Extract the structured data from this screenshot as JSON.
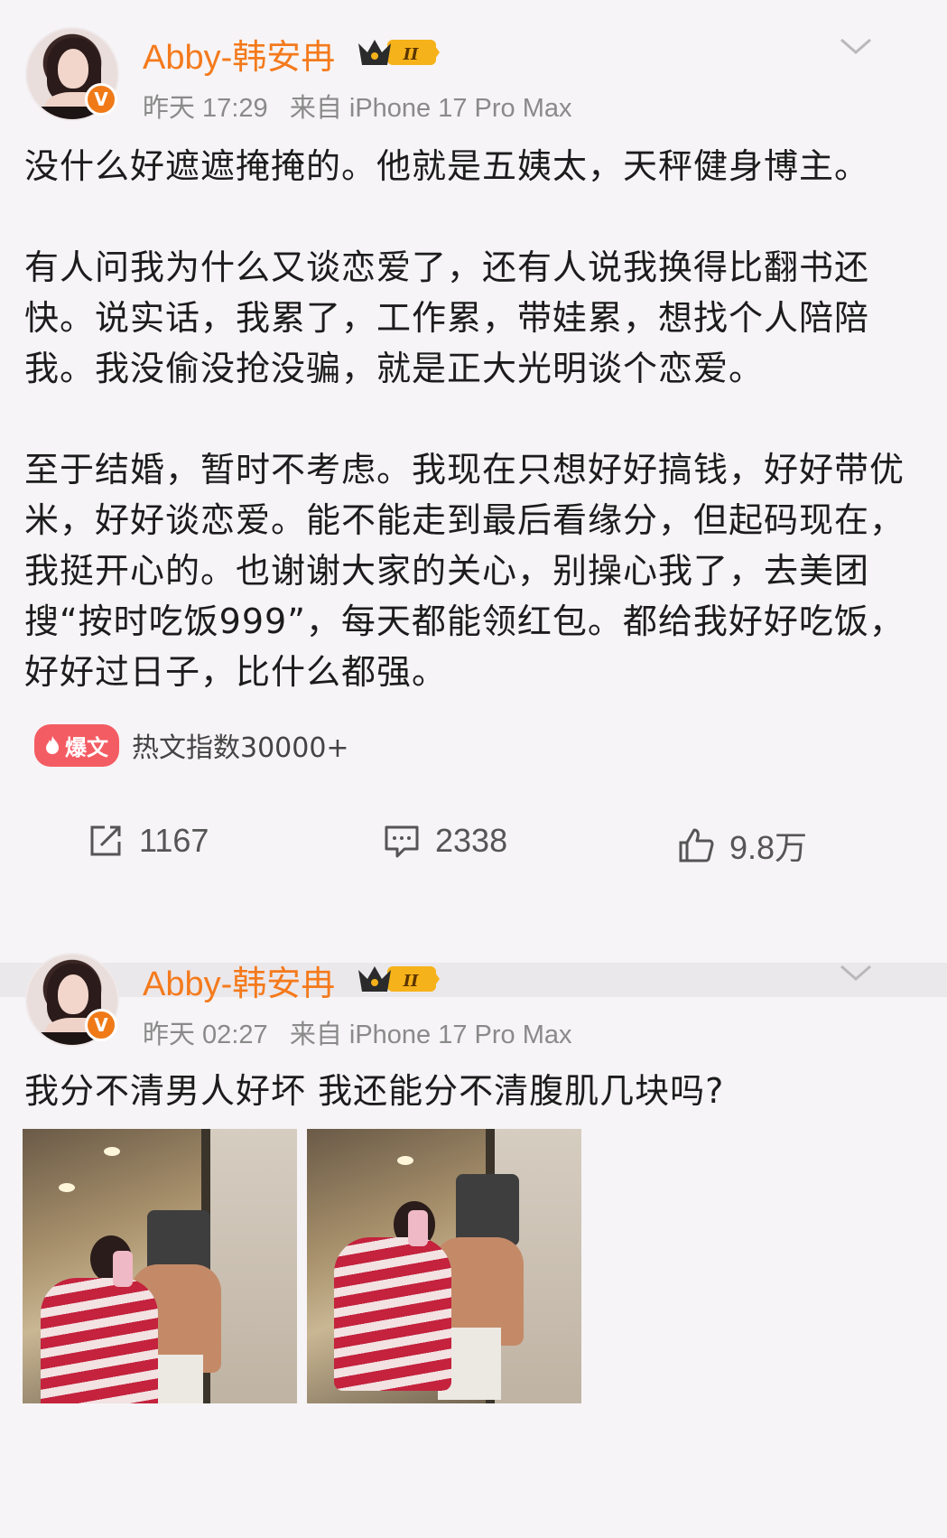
{
  "posts": [
    {
      "username": "Abby-韩安冉",
      "crown_level": "II",
      "time": "昨天 17:29",
      "source": "来自 iPhone 17 Pro Max",
      "paragraphs": [
        "没什么好遮遮掩掩的。他就是五姨太，天秤健身博主。",
        "有人问我为什么又谈恋爱了，还有人说我换得比翻书还快。说实话，我累了，工作累，带娃累，想找个人陪陪我。我没偷没抢没骗，就是正大光明谈个恋爱。",
        "至于结婚，暂时不考虑。我现在只想好好搞钱，好好带优米，好好谈恋爱。能不能走到最后看缘分，但起码现在，我挺开心的。也谢谢大家的关心，别操心我了，去美团搜“按时吃饭999”，每天都能领红包。都给我好好吃饭，好好过日子，比什么都强。"
      ],
      "hot_badge": "爆文",
      "hot_text": "热文指数30000+",
      "reposts": "1167",
      "comments": "2338",
      "likes": "9.8万"
    },
    {
      "username": "Abby-韩安冉",
      "crown_level": "II",
      "time": "昨天 02:27",
      "source": "来自 iPhone 17 Pro Max",
      "text": "我分不清男人好坏 我还能分不清腹肌几块吗?"
    }
  ],
  "verified_mark": "V",
  "colors": {
    "username": "#f47a1c",
    "hot_badge": "#f45c63",
    "verified": "#f07a18"
  }
}
